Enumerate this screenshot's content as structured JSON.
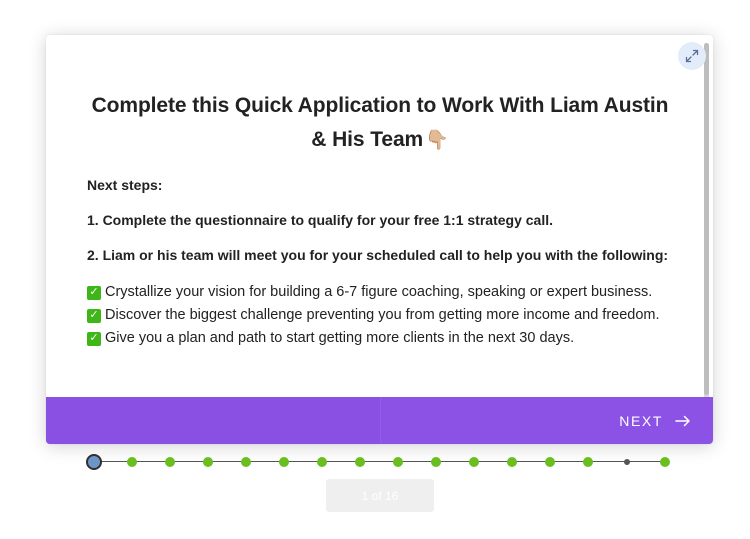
{
  "form": {
    "title_line1": "Complete this Quick Application to Work With Liam Austin",
    "title_line2": "& His Team",
    "title_emoji": "👇🏼",
    "next_steps_label": "Next steps:",
    "step1": "1. Complete the questionnaire to qualify for your free 1:1 strategy call.",
    "step2": "2. Liam or his team will meet you for your scheduled call to help you with the following:",
    "benefits": [
      "Crystallize your vision for building a 6-7 figure coaching, speaking or expert business.",
      "Discover the biggest challenge preventing you from getting more income and freedom.",
      "Give you a plan and path to start getting more clients in the next 30 days."
    ],
    "check_glyph": "✓"
  },
  "footer": {
    "next_label": "NEXT",
    "color": "#8c52e6"
  },
  "progress": {
    "current_step": 1,
    "total_steps": 16,
    "page_label": "1 of 16",
    "completed_color": "#6abf1f",
    "current_color": "#6d96c8"
  },
  "icons": {
    "expand": "expand-icon",
    "next_arrow": "arrow-right-icon",
    "check": "check-box-icon"
  }
}
